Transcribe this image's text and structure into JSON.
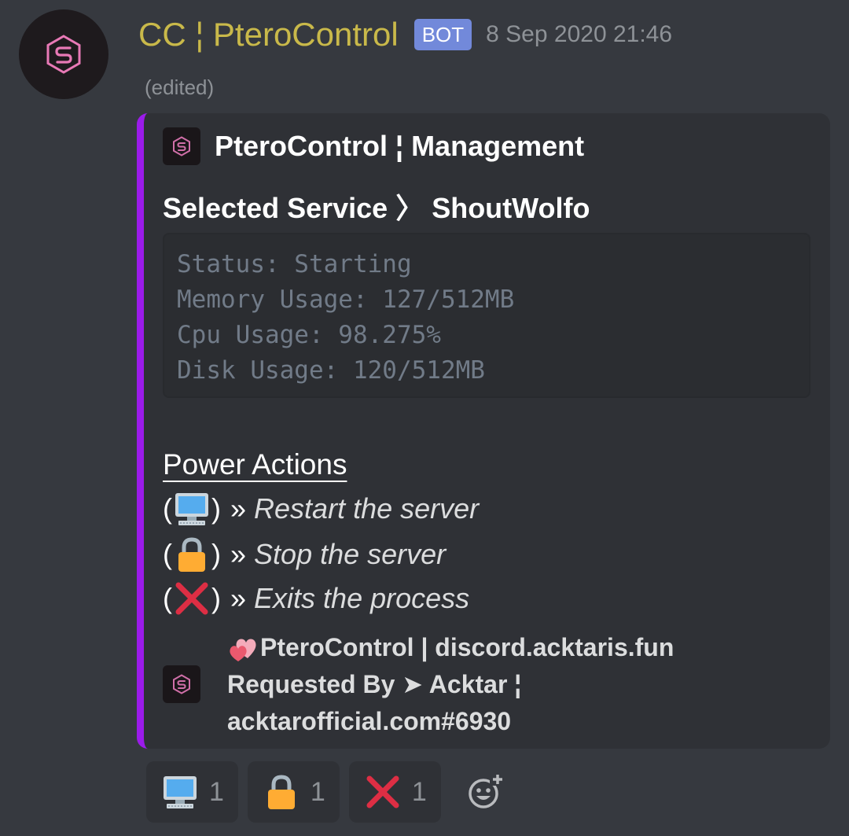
{
  "message": {
    "username": "CC ¦ PteroControl",
    "bot_tag": "BOT",
    "timestamp": "8 Sep 2020 21:46",
    "edited_label": "(edited)"
  },
  "embed": {
    "accent_color": "#9b1bea",
    "author_name": "PteroControl ¦ Management",
    "title": "Selected Service 〉 ShoutWolfo",
    "code_lines": [
      "Status: Starting",
      "Memory Usage: 127/512MB",
      "Cpu Usage: 98.275%",
      "Disk Usage: 120/512MB"
    ],
    "section_title": "Power Actions",
    "actions": [
      {
        "icon": "computer-icon",
        "paren_open": "(",
        "paren_close": ")",
        "separator": "»",
        "text": "Restart the server"
      },
      {
        "icon": "lock-icon",
        "paren_open": "(",
        "paren_close": ")",
        "separator": "»",
        "text": "Stop the server"
      },
      {
        "icon": "cross-mark-icon",
        "paren_open": "(",
        "paren_close": ")",
        "separator": "»",
        "text": "Exits the process"
      }
    ],
    "footer": {
      "icon": "two-hearts-icon",
      "line1": "PteroControl | discord.acktaris.fun",
      "line2": "Requested By ➤ Acktar ¦",
      "line3": "acktarofficial.com#6930"
    }
  },
  "reactions": [
    {
      "icon": "computer-icon",
      "count": "1"
    },
    {
      "icon": "lock-icon",
      "count": "1"
    },
    {
      "icon": "cross-mark-icon",
      "count": "1"
    }
  ],
  "add_reaction_icon": "add-reaction-icon",
  "colors": {
    "background": "#36393f",
    "embed_bg": "#2f3136",
    "username": "#c9b94a",
    "bot_tag": "#7289da"
  }
}
